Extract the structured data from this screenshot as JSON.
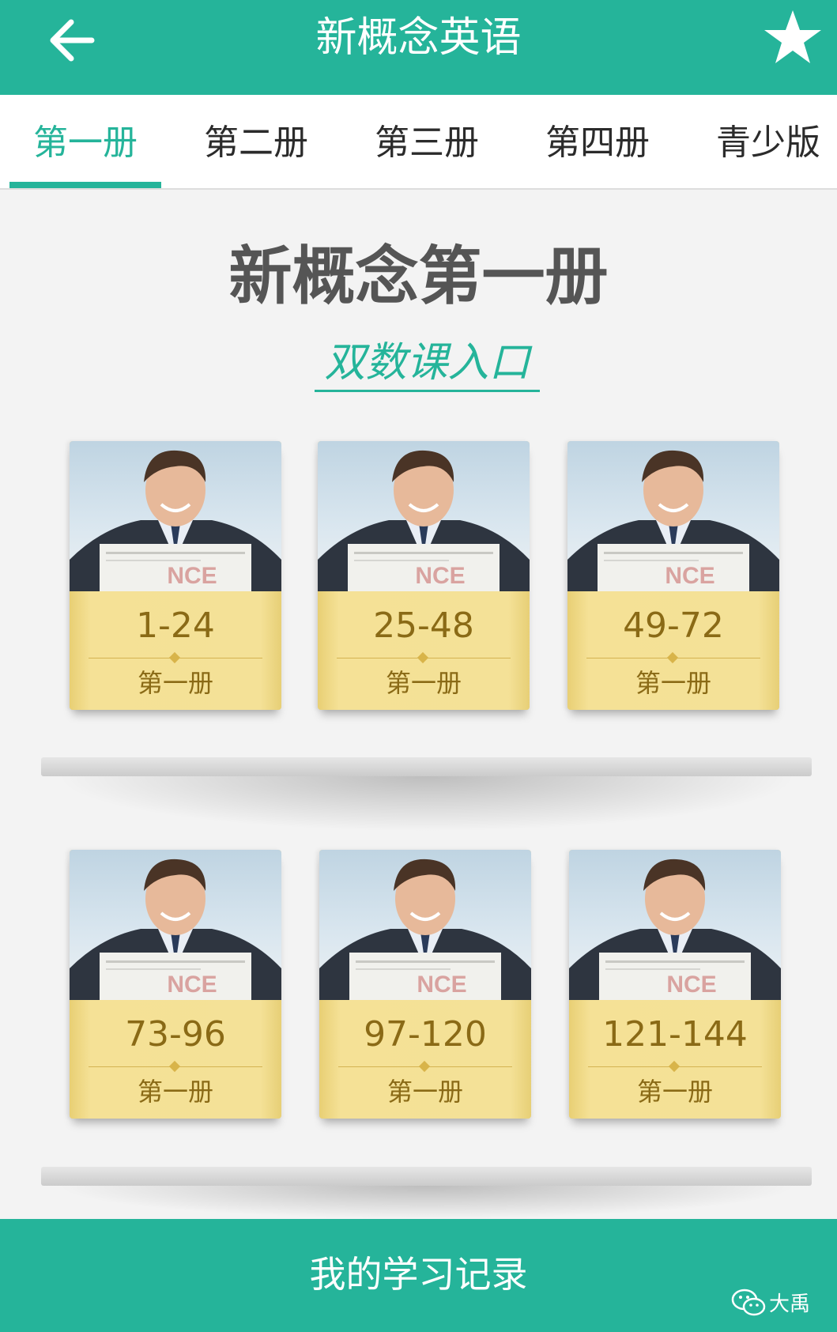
{
  "header": {
    "title": "新概念英语",
    "back_icon": "arrow-left-icon",
    "favorite_icon": "star-icon"
  },
  "tabs": [
    {
      "label": "第一册",
      "active": true
    },
    {
      "label": "第二册",
      "active": false
    },
    {
      "label": "第三册",
      "active": false
    },
    {
      "label": "第四册",
      "active": false
    },
    {
      "label": "青少版",
      "active": false
    }
  ],
  "main": {
    "heading": "新概念第一册",
    "entry_link": "双数课入口"
  },
  "books": [
    {
      "cover_logo": "NCE",
      "range": "1-24",
      "volume": "第一册"
    },
    {
      "cover_logo": "NCE",
      "range": "25-48",
      "volume": "第一册"
    },
    {
      "cover_logo": "NCE",
      "range": "49-72",
      "volume": "第一册"
    },
    {
      "cover_logo": "NCE",
      "range": "73-96",
      "volume": "第一册"
    },
    {
      "cover_logo": "NCE",
      "range": "97-120",
      "volume": "第一册"
    },
    {
      "cover_logo": "NCE",
      "range": "121-144",
      "volume": "第一册"
    }
  ],
  "footer": {
    "record_label": "我的学习记录",
    "watermark": "大禹",
    "watermark_icon": "wechat-icon"
  },
  "colors": {
    "accent": "#25b49a",
    "page_background": "#f3f3f3",
    "book_label": "#f2dc8c",
    "book_text": "#8a6a16"
  }
}
